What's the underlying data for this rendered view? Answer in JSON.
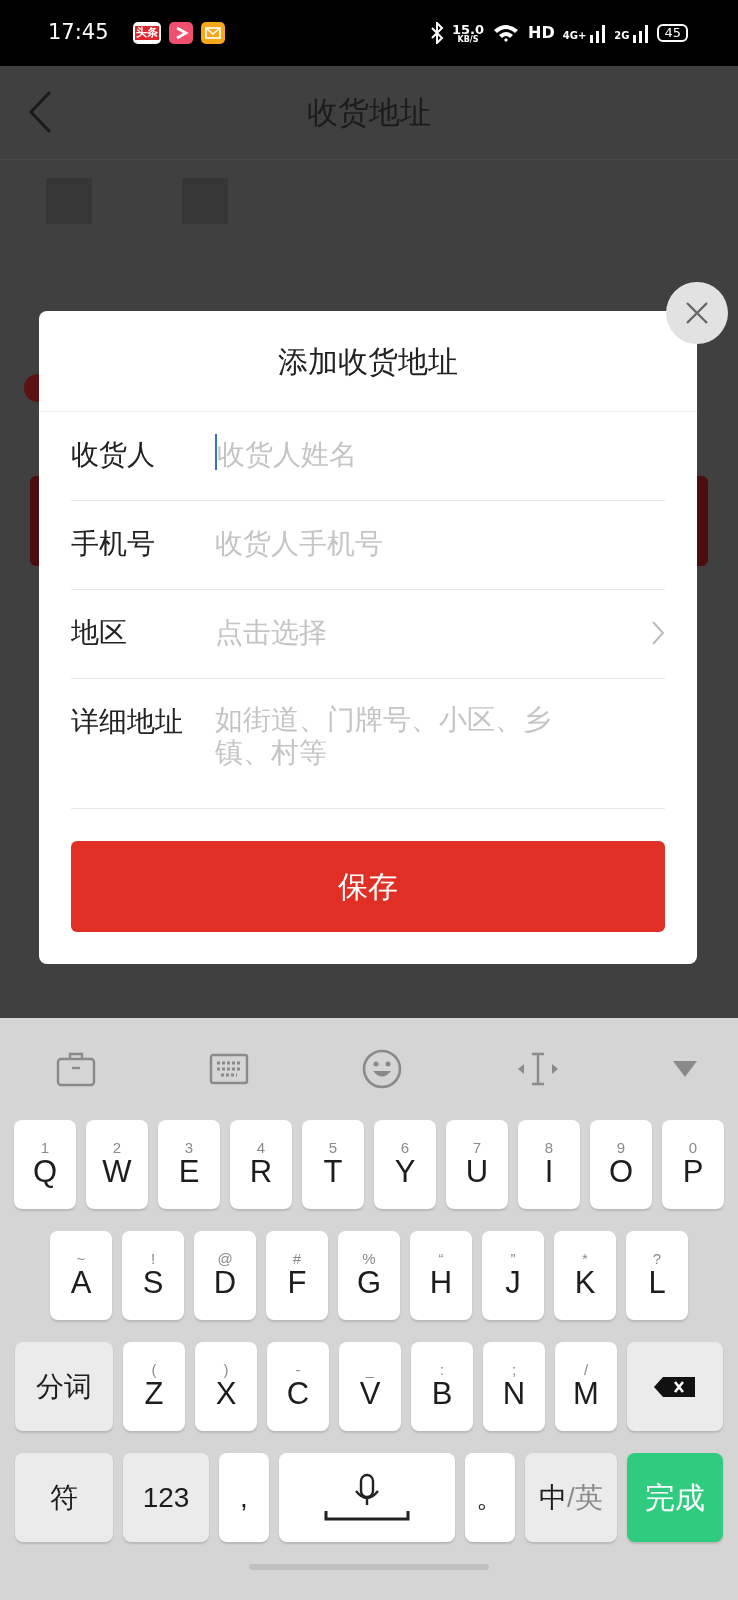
{
  "status_bar": {
    "time": "17:45",
    "app_icons": [
      {
        "kind": "news",
        "label": "头条"
      },
      {
        "kind": "video"
      },
      {
        "kind": "mail"
      }
    ],
    "speed": "15.0",
    "speed_unit": "KB/S",
    "hd": "HD",
    "networks": [
      "4G+",
      "2G"
    ],
    "battery": "45"
  },
  "page": {
    "title": "收货地址"
  },
  "dialog": {
    "title": "添加收货地址",
    "fields": [
      {
        "kind": "text",
        "label": "收货人",
        "placeholder": "收货人姓名",
        "focused": true
      },
      {
        "kind": "text",
        "label": "手机号",
        "placeholder": "收货人手机号",
        "focused": false
      },
      {
        "kind": "select",
        "label": "地区",
        "placeholder": "点击选择",
        "focused": false
      },
      {
        "kind": "textarea",
        "label": "详细地址",
        "placeholder": "如街道、门牌号、小区、乡镇、村等",
        "focused": false
      }
    ],
    "save_button": "保存"
  },
  "keyboard": {
    "rows": [
      {
        "keys": [
          {
            "kind": "letter",
            "label": "Q",
            "sub": "1"
          },
          {
            "kind": "letter",
            "label": "W",
            "sub": "2"
          },
          {
            "kind": "letter",
            "label": "E",
            "sub": "3"
          },
          {
            "kind": "letter",
            "label": "R",
            "sub": "4"
          },
          {
            "kind": "letter",
            "label": "T",
            "sub": "5"
          },
          {
            "kind": "letter",
            "label": "Y",
            "sub": "6"
          },
          {
            "kind": "letter",
            "label": "U",
            "sub": "7"
          },
          {
            "kind": "letter",
            "label": "I",
            "sub": "8"
          },
          {
            "kind": "letter",
            "label": "O",
            "sub": "9"
          },
          {
            "kind": "letter",
            "label": "P",
            "sub": "0"
          }
        ]
      },
      {
        "keys": [
          {
            "kind": "letter",
            "label": "A",
            "sub": "~"
          },
          {
            "kind": "letter",
            "label": "S",
            "sub": "!"
          },
          {
            "kind": "letter",
            "label": "D",
            "sub": "@"
          },
          {
            "kind": "letter",
            "label": "F",
            "sub": "#"
          },
          {
            "kind": "letter",
            "label": "G",
            "sub": "%"
          },
          {
            "kind": "letter",
            "label": "H",
            "sub": "“"
          },
          {
            "kind": "letter",
            "label": "J",
            "sub": "”"
          },
          {
            "kind": "letter",
            "label": "K",
            "sub": "*"
          },
          {
            "kind": "letter",
            "label": "L",
            "sub": "?"
          }
        ]
      },
      {
        "keys": [
          {
            "kind": "wide",
            "label": "分词"
          },
          {
            "kind": "letter",
            "label": "Z",
            "sub": "("
          },
          {
            "kind": "letter",
            "label": "X",
            "sub": ")"
          },
          {
            "kind": "letter",
            "label": "C",
            "sub": "-"
          },
          {
            "kind": "letter",
            "label": "V",
            "sub": "_"
          },
          {
            "kind": "letter",
            "label": "B",
            "sub": ":"
          },
          {
            "kind": "letter",
            "label": "N",
            "sub": ";"
          },
          {
            "kind": "letter",
            "label": "M",
            "sub": "/"
          },
          {
            "kind": "backspace"
          }
        ]
      },
      {
        "keys": [
          {
            "kind": "wide",
            "label": "符"
          },
          {
            "kind": "mid",
            "label": "123"
          },
          {
            "kind": "punct",
            "label": ","
          },
          {
            "kind": "space"
          },
          {
            "kind": "punct",
            "label": "。"
          },
          {
            "kind": "lang",
            "label": "中",
            "sub": "/英"
          },
          {
            "kind": "done",
            "label": "完成"
          }
        ]
      }
    ]
  }
}
